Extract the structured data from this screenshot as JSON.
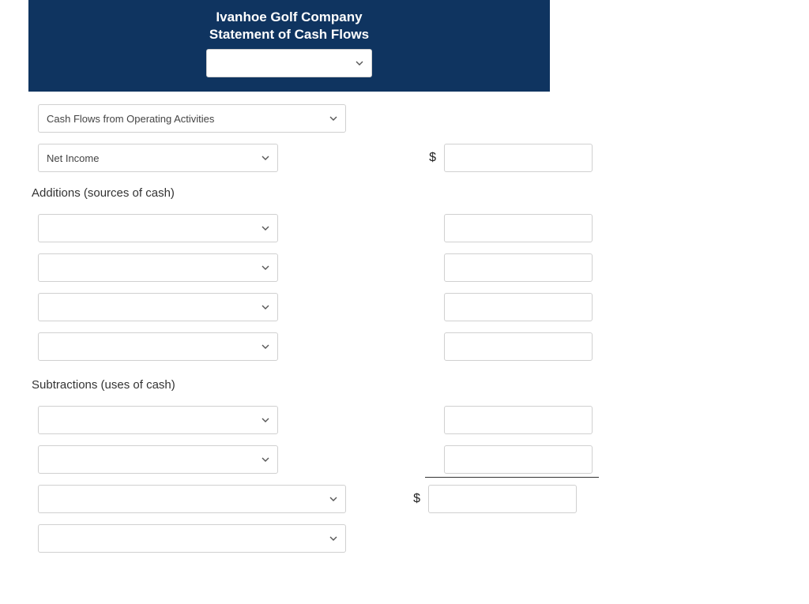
{
  "header": {
    "company": "Ivanhoe Golf Company",
    "statement": "Statement of Cash Flows",
    "period_select_value": ""
  },
  "section_select": {
    "value": "Cash Flows from Operating Activities"
  },
  "net_income": {
    "label": "Net Income",
    "currency": "$",
    "amount": ""
  },
  "additions": {
    "heading": "Additions (sources of cash)",
    "items": [
      {
        "label": "",
        "amount": ""
      },
      {
        "label": "",
        "amount": ""
      },
      {
        "label": "",
        "amount": ""
      },
      {
        "label": "",
        "amount": ""
      }
    ]
  },
  "subtractions": {
    "heading": "Subtractions (uses of cash)",
    "items": [
      {
        "label": "",
        "amount": ""
      },
      {
        "label": "",
        "amount": ""
      }
    ]
  },
  "total_row": {
    "label": "",
    "currency": "$",
    "amount": ""
  },
  "footer_select": {
    "value": ""
  }
}
